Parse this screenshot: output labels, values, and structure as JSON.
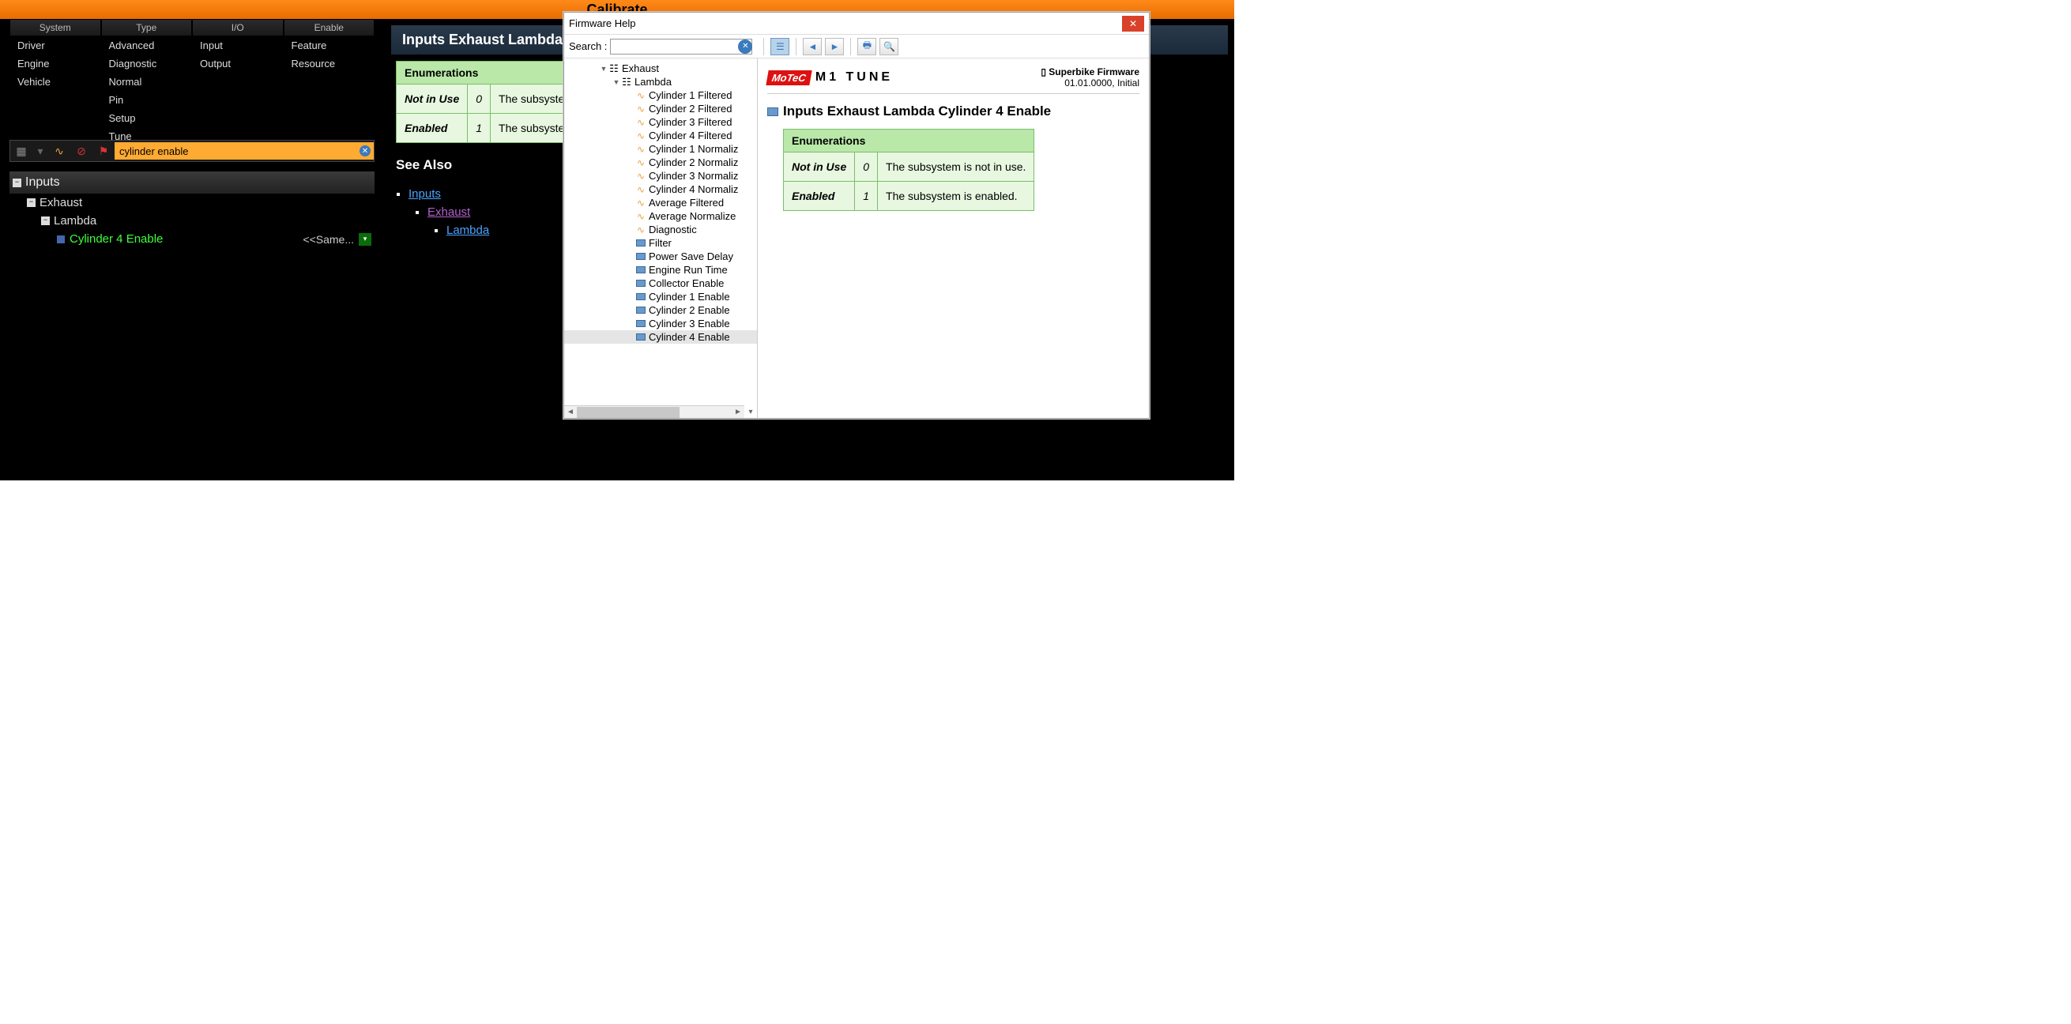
{
  "topbar_title": "Calibrate",
  "categories": {
    "headers": [
      "System",
      "Type",
      "I/O",
      "Enable"
    ],
    "cols": [
      [
        "Driver",
        "Engine",
        "Vehicle"
      ],
      [
        "Advanced",
        "Diagnostic",
        "Normal",
        "Pin",
        "Setup",
        "Tune"
      ],
      [
        "Input",
        "Output"
      ],
      [
        "Feature",
        "Resource"
      ]
    ]
  },
  "search_value": "cylinder enable",
  "tree": {
    "root": "Inputs",
    "l1": "Exhaust",
    "l2": "Lambda",
    "leaf": "Cylinder 4 Enable",
    "leaf_value": "<<Same..."
  },
  "main": {
    "title": "Inputs Exhaust Lambda",
    "enum_header": "Enumerations",
    "enum_rows": [
      {
        "name": "Not in Use",
        "val": "0",
        "desc": "The subsystem"
      },
      {
        "name": "Enabled",
        "val": "1",
        "desc": "The subsystem"
      }
    ],
    "see_also_title": "See Also",
    "see_also": [
      {
        "label": "Inputs",
        "visited": false,
        "lvl": 0
      },
      {
        "label": "Exhaust",
        "visited": true,
        "lvl": 1
      },
      {
        "label": "Lambda",
        "visited": false,
        "lvl": 2
      }
    ]
  },
  "help": {
    "title": "Firmware Help",
    "search_label": "Search :",
    "tree": [
      {
        "lvl": 0,
        "icon": "folder",
        "label": "Exhaust",
        "exp": true
      },
      {
        "lvl": 1,
        "icon": "folder",
        "label": "Lambda",
        "exp": true
      },
      {
        "lvl": 2,
        "icon": "wave",
        "label": "Cylinder 1 Filtered"
      },
      {
        "lvl": 2,
        "icon": "wave",
        "label": "Cylinder 2 Filtered"
      },
      {
        "lvl": 2,
        "icon": "wave",
        "label": "Cylinder 3 Filtered"
      },
      {
        "lvl": 2,
        "icon": "wave",
        "label": "Cylinder 4 Filtered"
      },
      {
        "lvl": 2,
        "icon": "wave",
        "label": "Cylinder 1 Normaliz"
      },
      {
        "lvl": 2,
        "icon": "wave",
        "label": "Cylinder 2 Normaliz"
      },
      {
        "lvl": 2,
        "icon": "wave",
        "label": "Cylinder 3 Normaliz"
      },
      {
        "lvl": 2,
        "icon": "wave",
        "label": "Cylinder 4 Normaliz"
      },
      {
        "lvl": 2,
        "icon": "wave",
        "label": "Average Filtered"
      },
      {
        "lvl": 2,
        "icon": "wave",
        "label": "Average Normalize"
      },
      {
        "lvl": 2,
        "icon": "wave",
        "label": "Diagnostic"
      },
      {
        "lvl": 2,
        "icon": "box",
        "label": "Filter"
      },
      {
        "lvl": 2,
        "icon": "box",
        "label": "Power Save Delay"
      },
      {
        "lvl": 2,
        "icon": "box",
        "label": "Engine Run Time"
      },
      {
        "lvl": 2,
        "icon": "box",
        "label": "Collector Enable"
      },
      {
        "lvl": 2,
        "icon": "box",
        "label": "Cylinder 1 Enable"
      },
      {
        "lvl": 2,
        "icon": "box",
        "label": "Cylinder 2 Enable"
      },
      {
        "lvl": 2,
        "icon": "box",
        "label": "Cylinder 3 Enable"
      },
      {
        "lvl": 2,
        "icon": "box",
        "label": "Cylinder 4 Enable",
        "sel": true
      }
    ],
    "brand_motec": "MoTeC",
    "brand_tune": "M1 TUNE",
    "fw_name": "Superbike Firmware",
    "fw_ver": "01.01.0000, Initial",
    "content_title": "Inputs Exhaust Lambda Cylinder 4 Enable",
    "enum_header": "Enumerations",
    "enum_rows": [
      {
        "name": "Not in Use",
        "val": "0",
        "desc": "The subsystem is not in use."
      },
      {
        "name": "Enabled",
        "val": "1",
        "desc": "The subsystem is enabled."
      }
    ]
  }
}
